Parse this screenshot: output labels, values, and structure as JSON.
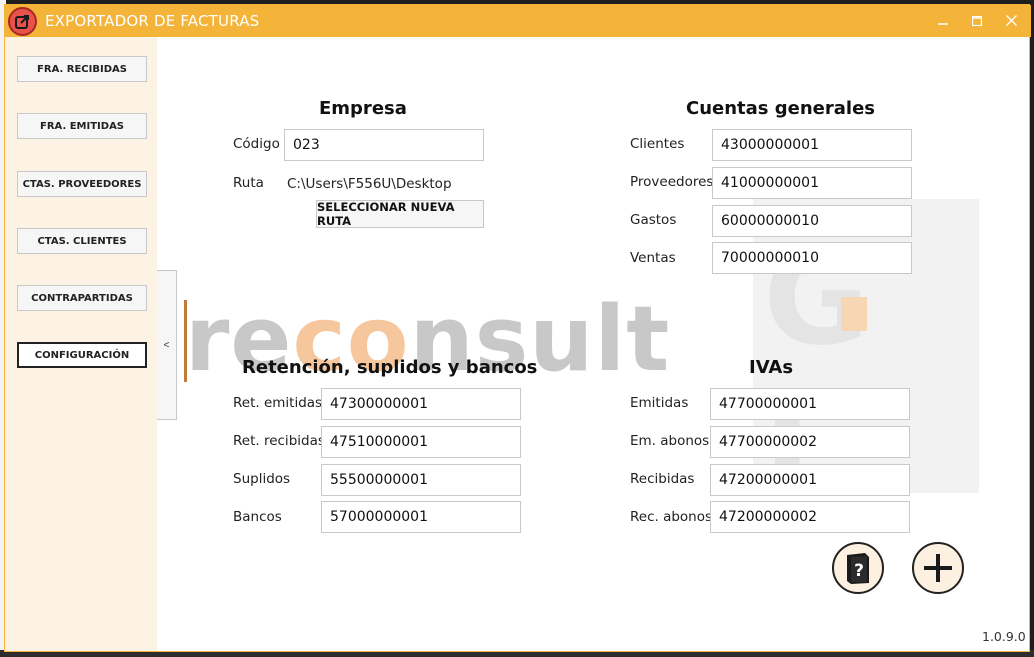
{
  "window": {
    "title": "EXPORTADOR DE FACTURAS",
    "minimize": "🗕",
    "maximize": "🗖",
    "close": "✕",
    "accent_color": "#f4b43a"
  },
  "sidebar": {
    "items": [
      {
        "label": "FRA. RECIBIDAS"
      },
      {
        "label": "FRA. EMITIDAS"
      },
      {
        "label": "CTAS. PROVEEDORES"
      },
      {
        "label": "CTAS. CLIENTES"
      },
      {
        "label": "CONTRAPARTIDAS"
      },
      {
        "label": "CONFIGURACIÓN"
      }
    ],
    "active": "CONFIGURACIÓN",
    "collapse": "<"
  },
  "empresa": {
    "heading": "Empresa",
    "codigo_label": "Código",
    "codigo_value": "023",
    "ruta_label": "Ruta",
    "ruta_value": "C:\\Users\\F556U\\Desktop",
    "select_button": "SELECCIONAR NUEVA RUTA"
  },
  "cuentas": {
    "heading": "Cuentas generales",
    "rows": [
      {
        "label": "Clientes",
        "value": "43000000001"
      },
      {
        "label": "Proveedores",
        "value": "41000000001"
      },
      {
        "label": "Gastos",
        "value": "60000000010"
      },
      {
        "label": "Ventas",
        "value": "70000000010"
      }
    ]
  },
  "retencion": {
    "heading": "Retención, suplidos y bancos",
    "rows": [
      {
        "label": "Ret. emitidas",
        "value": "47300000001"
      },
      {
        "label": "Ret. recibidas",
        "value": "47510000001"
      },
      {
        "label": "Suplidos",
        "value": "55500000001"
      },
      {
        "label": "Bancos",
        "value": "57000000001"
      }
    ]
  },
  "ivas": {
    "heading": "IVAs",
    "rows": [
      {
        "label": "Emitidas",
        "value": "47700000001"
      },
      {
        "label": "Em. abonos",
        "value": "47700000002"
      },
      {
        "label": "Recibidas",
        "value": "47200000001"
      },
      {
        "label": "Rec. abonos",
        "value": "47200000002"
      }
    ]
  },
  "watermark": {
    "part1": "re",
    "part2": "co",
    "part3": "nsult"
  },
  "icons": {
    "help": "help-book-icon",
    "add": "plus-icon"
  },
  "version": "1.0.9.0"
}
